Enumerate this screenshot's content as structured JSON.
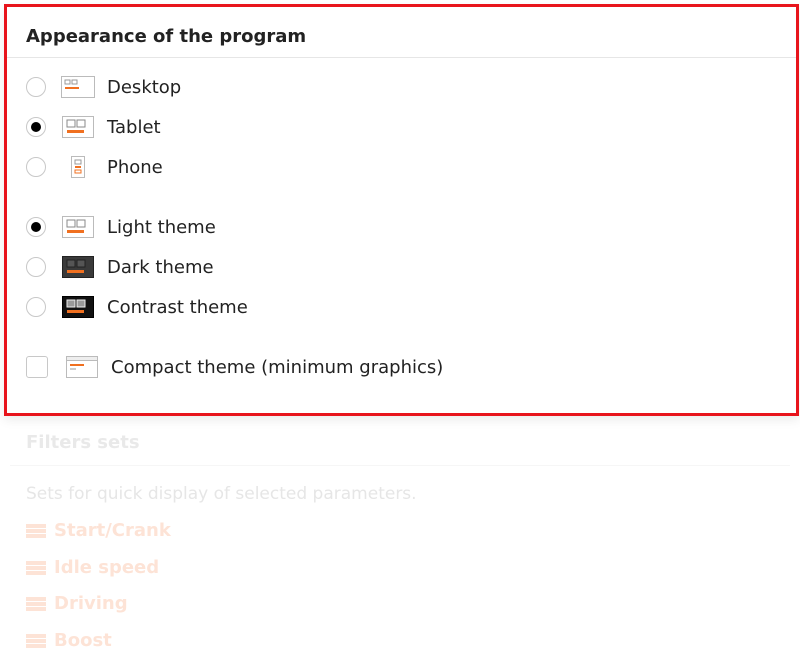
{
  "panel": {
    "title": "Appearance of the program",
    "layout_options": [
      {
        "label": "Desktop",
        "selected": false,
        "icon": "desktop-layout-icon"
      },
      {
        "label": "Tablet",
        "selected": true,
        "icon": "tablet-layout-icon"
      },
      {
        "label": "Phone",
        "selected": false,
        "icon": "phone-layout-icon"
      }
    ],
    "theme_options": [
      {
        "label": "Light theme",
        "selected": true,
        "icon": "light-theme-icon"
      },
      {
        "label": "Dark theme",
        "selected": false,
        "icon": "dark-theme-icon"
      },
      {
        "label": "Contrast theme",
        "selected": false,
        "icon": "contrast-theme-icon"
      }
    ],
    "compact": {
      "label": "Compact theme (minimum graphics)",
      "checked": false,
      "icon": "compact-theme-icon"
    }
  },
  "filters": {
    "title": "Filters sets",
    "description": "Sets for quick display of selected parameters.",
    "items": [
      "Start/Crank",
      "Idle speed",
      "Driving",
      "Boost"
    ]
  },
  "colors": {
    "highlight_border": "#e8141c",
    "accent": "#f07020"
  }
}
